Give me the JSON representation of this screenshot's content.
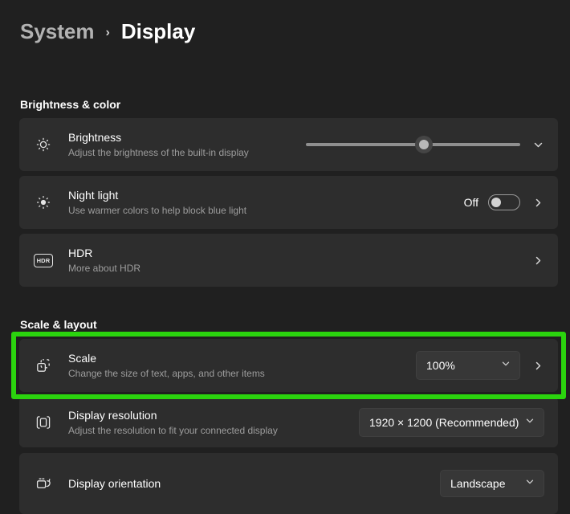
{
  "colors": {
    "background": "#202020",
    "card": "#2d2d2d",
    "control": "#373737",
    "highlight": "#2bd40e",
    "text_primary": "#ffffff",
    "text_secondary": "#9d9d9d"
  },
  "breadcrumb": {
    "parent": "System",
    "separator": "›",
    "current": "Display"
  },
  "sections": {
    "brightness_color": {
      "label": "Brightness & color",
      "rows": {
        "brightness": {
          "title": "Brightness",
          "subtitle": "Adjust the brightness of the built-in display",
          "slider": {
            "value": 55
          }
        },
        "night_light": {
          "title": "Night light",
          "subtitle": "Use warmer colors to help block blue light",
          "toggle_label": "Off",
          "toggle_state": "off"
        },
        "hdr": {
          "icon_text": "HDR",
          "title": "HDR",
          "subtitle": "More about HDR"
        }
      }
    },
    "scale_layout": {
      "label": "Scale & layout",
      "rows": {
        "scale": {
          "title": "Scale",
          "subtitle": "Change the size of text, apps, and other items",
          "dropdown_value": "100%",
          "highlighted": true
        },
        "display_resolution": {
          "title": "Display resolution",
          "subtitle": "Adjust the resolution to fit your connected display",
          "dropdown_value": "1920 × 1200 (Recommended)"
        },
        "display_orientation": {
          "title": "Display orientation",
          "dropdown_value": "Landscape"
        }
      }
    }
  }
}
